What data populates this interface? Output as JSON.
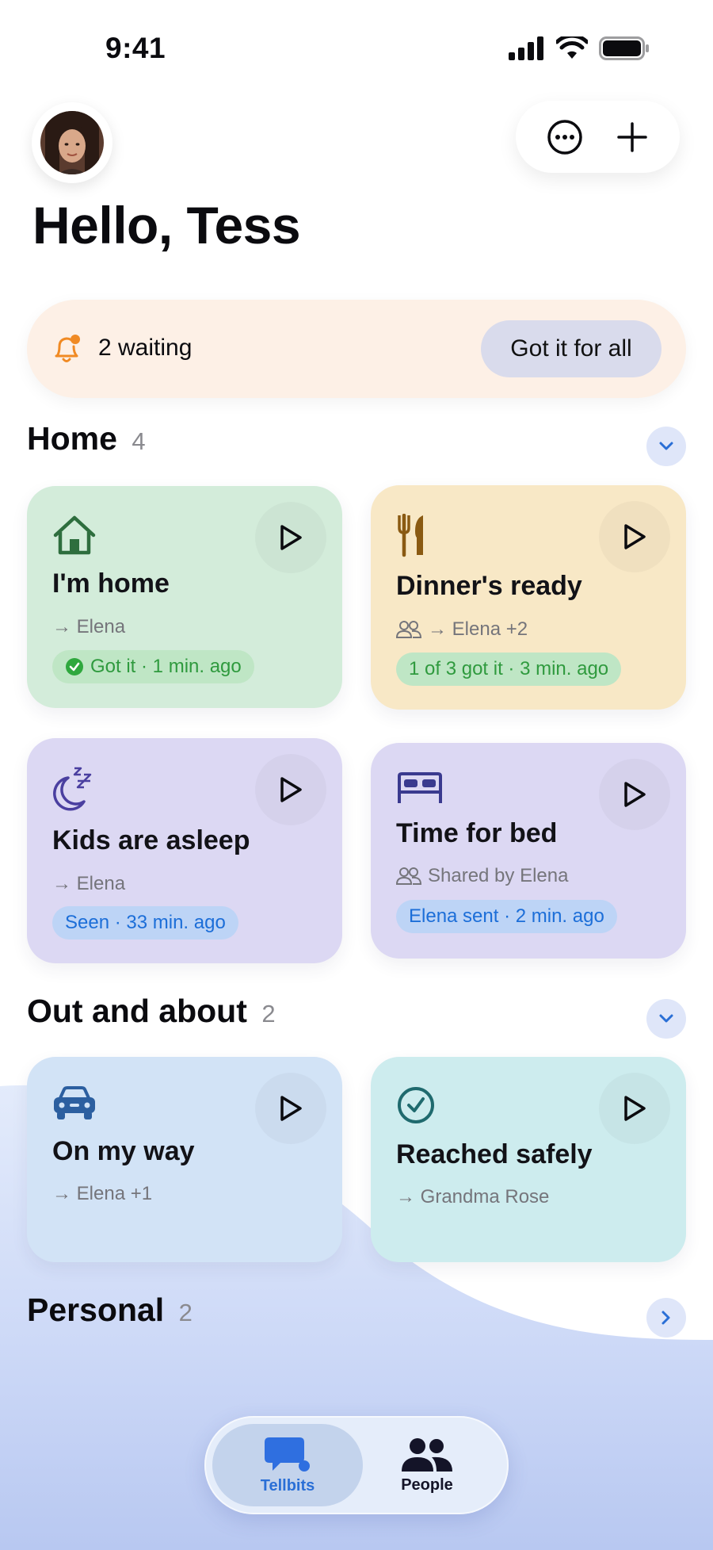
{
  "status_bar": {
    "time": "9:41"
  },
  "header": {
    "greeting": "Hello, Tess"
  },
  "banner": {
    "text": "2 waiting",
    "button": "Got it for all"
  },
  "sections": [
    {
      "title": "Home",
      "count": "4"
    },
    {
      "title": "Out and about",
      "count": "2"
    },
    {
      "title": "Personal",
      "count": "2"
    }
  ],
  "cards": [
    {
      "title": "I'm home",
      "sub": "→ Elena",
      "badge": "Got it · 1 min. ago",
      "icon": "house-icon",
      "color": "#d3ecda"
    },
    {
      "title": "Dinner's ready",
      "sub": "→ Elena +2",
      "badge": "1 of 3 got it · 3 min. ago",
      "icon": "fork-knife-icon",
      "color": "#f8e8c6"
    },
    {
      "title": "Kids are asleep",
      "sub": "→ Elena",
      "badge": "Seen · 33 min. ago",
      "icon": "moon-zzz-icon",
      "color": "#dcd8f3"
    },
    {
      "title": "Time for bed",
      "sub": "Shared by Elena",
      "badge": "Elena sent · 2 min. ago",
      "icon": "bed-icon",
      "color": "#dcd8f3"
    },
    {
      "title": "On my way",
      "sub": "→ Elena +1",
      "icon": "car-icon",
      "color": "#d2e3f6"
    },
    {
      "title": "Reached safely",
      "sub": "→ Grandma Rose",
      "icon": "checkmark-circle-icon",
      "color": "#cdecee"
    }
  ],
  "tabs": [
    {
      "label": "Tellbits",
      "icon": "chat-bubble-icon",
      "active": true
    },
    {
      "label": "People",
      "icon": "people-icon",
      "active": false
    }
  ],
  "colors": {
    "accent_blue": "#1c6ed8",
    "green": "#2f9a3e",
    "bell_orange": "#f08a24"
  }
}
